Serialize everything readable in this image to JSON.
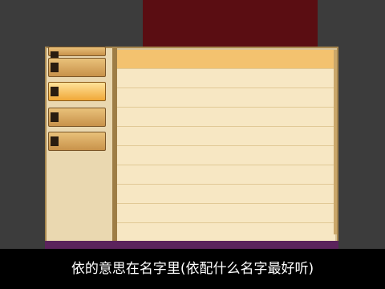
{
  "subtitle": "依的意思在名字里(依配什么名字最好听)",
  "sidebar": {
    "tabs": [
      {
        "tag": "",
        "active": false
      },
      {
        "tag": "",
        "active": false
      },
      {
        "tag": "",
        "active": true
      },
      {
        "tag": "",
        "active": false
      },
      {
        "tag": "",
        "active": false
      }
    ]
  },
  "list": {
    "rows": [
      {
        "idx": "",
        "name": "",
        "value": "",
        "selected": true
      },
      {
        "idx": "",
        "name": "",
        "value": "",
        "selected": false
      },
      {
        "idx": "",
        "name": "",
        "value": "",
        "selected": false
      },
      {
        "idx": "",
        "name": "",
        "value": "",
        "selected": false
      },
      {
        "idx": "",
        "name": "",
        "value": "",
        "selected": false
      },
      {
        "idx": "",
        "name": "",
        "value": "",
        "selected": false
      },
      {
        "idx": "",
        "name": "",
        "value": "",
        "selected": false
      },
      {
        "idx": "",
        "name": "",
        "value": "",
        "selected": false
      },
      {
        "idx": "",
        "name": "",
        "value": "",
        "selected": false
      },
      {
        "idx": "",
        "name": "",
        "value": "",
        "selected": false
      }
    ]
  },
  "colors": {
    "banner": "#5a0d12",
    "panel": "#d7c39a",
    "selected_row": "#f3c26f",
    "bottom_bar": "#5b235c"
  }
}
